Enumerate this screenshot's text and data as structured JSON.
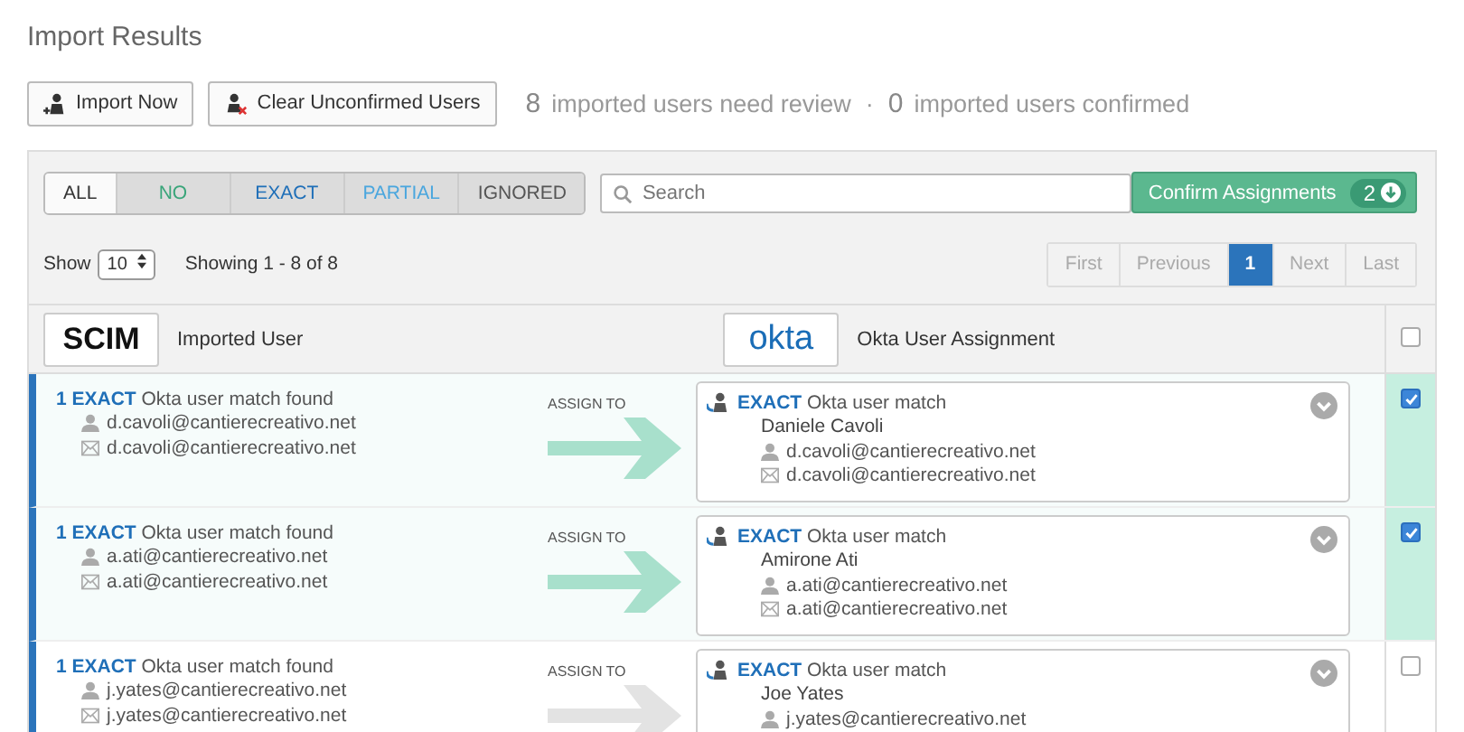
{
  "page_title": "Import Results",
  "actions": [
    {
      "label": "Import Now",
      "kind": "import"
    },
    {
      "label": "Clear Unconfirmed Users",
      "kind": "clear"
    }
  ],
  "summary": {
    "review_count": "8",
    "review_text": "imported users need review",
    "separator": "·",
    "confirmed_count": "0",
    "confirmed_text": "imported users confirmed"
  },
  "filters": [
    {
      "label": "ALL",
      "selected": true,
      "color": "#333333"
    },
    {
      "label": "NO",
      "selected": false,
      "color": "#3aa57a"
    },
    {
      "label": "EXACT",
      "selected": false,
      "color": "#1f6fb8"
    },
    {
      "label": "PARTIAL",
      "selected": false,
      "color": "#4aa6de"
    },
    {
      "label": "IGNORED",
      "selected": false,
      "color": "#555555"
    }
  ],
  "search": {
    "placeholder": "Search"
  },
  "confirm": {
    "label": "Confirm Assignments",
    "count": "2"
  },
  "show": {
    "label": "Show",
    "value": "10",
    "range": "Showing 1 - 8 of 8"
  },
  "pagination": [
    {
      "label": "First",
      "selected": false,
      "disabled": true
    },
    {
      "label": "Previous",
      "selected": false,
      "disabled": true
    },
    {
      "label": "1",
      "selected": true,
      "disabled": false
    },
    {
      "label": "Next",
      "selected": false,
      "disabled": true
    },
    {
      "label": "Last",
      "selected": false,
      "disabled": true
    }
  ],
  "header": {
    "left_logo": "SCIM",
    "left_label": "Imported User",
    "right_logo": "okta",
    "right_label": "Okta User Assignment",
    "checked": false
  },
  "rows": [
    {
      "match_count": "1 EXACT",
      "match_text": "Okta user match found",
      "username": "d.cavoli@cantierecreativo.net",
      "email": "d.cavoli@cantierecreativo.net",
      "assign_label": "ASSIGN TO",
      "okta_match": "EXACT",
      "okta_match_text": "Okta user match",
      "okta_name": "Daniele Cavoli",
      "okta_username": "d.cavoli@cantierecreativo.net",
      "okta_email": "d.cavoli@cantierecreativo.net",
      "checked": true
    },
    {
      "match_count": "1 EXACT",
      "match_text": "Okta user match found",
      "username": "a.ati@cantierecreativo.net",
      "email": "a.ati@cantierecreativo.net",
      "assign_label": "ASSIGN TO",
      "okta_match": "EXACT",
      "okta_match_text": "Okta user match",
      "okta_name": "Amirone Ati",
      "okta_username": "a.ati@cantierecreativo.net",
      "okta_email": "a.ati@cantierecreativo.net",
      "checked": true
    },
    {
      "match_count": "1 EXACT",
      "match_text": "Okta user match found",
      "username": "j.yates@cantierecreativo.net",
      "email": "j.yates@cantierecreativo.net",
      "assign_label": "ASSIGN TO",
      "okta_match": "EXACT",
      "okta_match_text": "Okta user match",
      "okta_name": "Joe Yates",
      "okta_username": "j.yates@cantierecreativo.net",
      "checked": false
    }
  ]
}
